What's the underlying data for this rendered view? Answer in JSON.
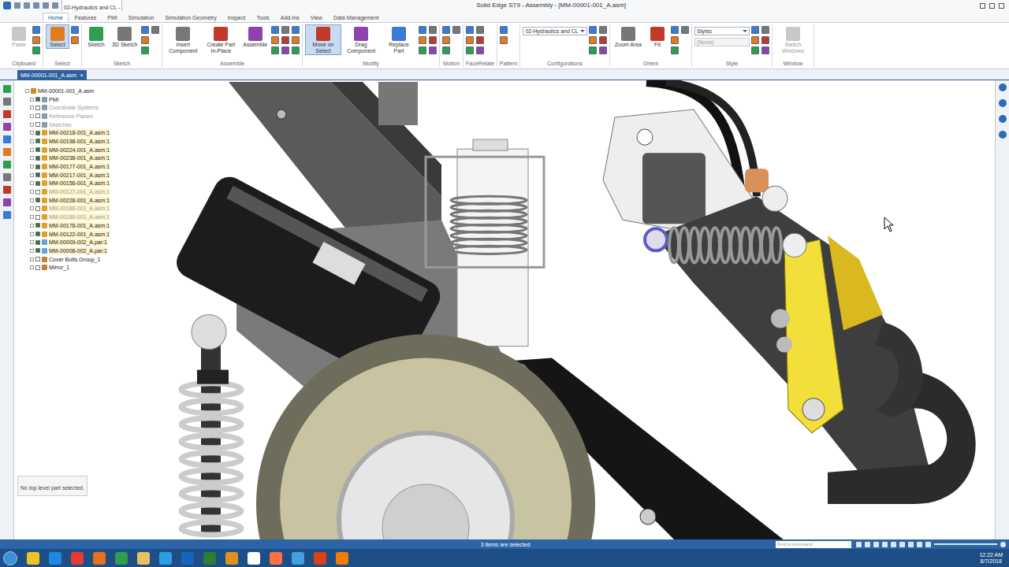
{
  "window": {
    "title": "Solid Edge ST9 - Assembly - [MM-00001-001_A.asm]",
    "quick_tab": "02-Hydraulics and CL -"
  },
  "ribbon_tabs": [
    {
      "label": "Home",
      "selected": true
    },
    {
      "label": "Features",
      "selected": false
    },
    {
      "label": "PMI",
      "selected": false
    },
    {
      "label": "Simulation",
      "selected": false
    },
    {
      "label": "Simulation Geometry",
      "selected": false
    },
    {
      "label": "Inspect",
      "selected": false
    },
    {
      "label": "Tools",
      "selected": false
    },
    {
      "label": "Add-Ins",
      "selected": false
    },
    {
      "label": "View",
      "selected": false
    },
    {
      "label": "Data Management",
      "selected": false
    }
  ],
  "ribbon_groups": [
    {
      "label": "Clipboard",
      "buttons": [
        {
          "label": "Paste",
          "disabled": true,
          "selected": false
        }
      ]
    },
    {
      "label": "Select",
      "buttons": [
        {
          "label": "Select",
          "disabled": false,
          "selected": true
        }
      ]
    },
    {
      "label": "Sketch",
      "buttons": [
        {
          "label": "Sketch",
          "disabled": false,
          "selected": false
        },
        {
          "label": "3D Sketch",
          "disabled": false,
          "selected": false
        }
      ]
    },
    {
      "label": "Assemble",
      "buttons": [
        {
          "label": "Insert Component",
          "disabled": false,
          "selected": false
        },
        {
          "label": "Create Part In-Place",
          "disabled": false,
          "selected": false
        },
        {
          "label": "Assemble",
          "disabled": false,
          "selected": false
        }
      ]
    },
    {
      "label": "Modify",
      "buttons": [
        {
          "label": "Move on Select",
          "disabled": false,
          "selected": true
        },
        {
          "label": "Drag Component",
          "disabled": false,
          "selected": false
        },
        {
          "label": "Replace Part",
          "disabled": false,
          "selected": false
        }
      ]
    },
    {
      "label": "Motion",
      "buttons": []
    },
    {
      "label": "FaceRelate",
      "buttons": []
    },
    {
      "label": "Pattern",
      "buttons": []
    },
    {
      "label": "Configurations",
      "buttons": [],
      "dropdown": "02-Hydraulics and CL"
    },
    {
      "label": "Orient",
      "buttons": [
        {
          "label": "Zoom Area",
          "disabled": false,
          "selected": false
        },
        {
          "label": "Fit",
          "disabled": false,
          "selected": false
        }
      ]
    },
    {
      "label": "Style",
      "buttons": [],
      "dropdown": "Styles",
      "dropdown2": "(None)"
    },
    {
      "label": "Window",
      "buttons": [
        {
          "label": "Switch Windows",
          "disabled": true,
          "selected": false
        }
      ]
    }
  ],
  "document_tab": {
    "label": "MM-00001-001_A.asm",
    "close": "×"
  },
  "tree": {
    "items": [
      {
        "label": "MM-00001-001_A.asm",
        "kind": "root",
        "checked": false,
        "greyed": false
      },
      {
        "label": "PMI",
        "kind": "folder",
        "checked": true,
        "greyed": false
      },
      {
        "label": "Coordinate Systems",
        "kind": "folder",
        "checked": false,
        "greyed": true
      },
      {
        "label": "Reference Planes",
        "kind": "folder",
        "checked": false,
        "greyed": true
      },
      {
        "label": "Sketches",
        "kind": "folder",
        "checked": false,
        "greyed": true
      },
      {
        "label": "MM-00218-001_A.asm:1",
        "kind": "asm",
        "checked": true,
        "greyed": false
      },
      {
        "label": "MM-00198-001_A.asm:1",
        "kind": "asm",
        "checked": true,
        "greyed": false
      },
      {
        "label": "MM-00224-001_A.asm:1",
        "kind": "asm",
        "checked": true,
        "greyed": false
      },
      {
        "label": "MM-00238-001_A.asm:1",
        "kind": "asm",
        "checked": true,
        "greyed": false
      },
      {
        "label": "MM-00177-001_A.asm:1",
        "kind": "asm",
        "checked": true,
        "greyed": false
      },
      {
        "label": "MM-00217-001_A.asm:1",
        "kind": "asm",
        "checked": true,
        "greyed": false
      },
      {
        "label": "MM-00156-001_A.asm:1",
        "kind": "asm",
        "checked": true,
        "greyed": false
      },
      {
        "label": "MM-00127-001_A.asm:1",
        "kind": "asm",
        "checked": false,
        "greyed": true
      },
      {
        "label": "MM-00228-001_A.asm:1",
        "kind": "asm",
        "checked": true,
        "greyed": false
      },
      {
        "label": "MM-00188-001_A.asm:1",
        "kind": "asm",
        "checked": false,
        "greyed": true
      },
      {
        "label": "MM-00180-001_A.asm:1",
        "kind": "asm",
        "checked": false,
        "greyed": true
      },
      {
        "label": "MM-00178-001_A.asm:1",
        "kind": "asm",
        "checked": true,
        "greyed": false
      },
      {
        "label": "MM-00122-001_A.asm:1",
        "kind": "asm",
        "checked": true,
        "greyed": false
      },
      {
        "label": "MM-00009-002_A.par:1",
        "kind": "par",
        "checked": true,
        "greyed": false
      },
      {
        "label": "MM-00008-002_A.par:1",
        "kind": "par",
        "checked": true,
        "greyed": false
      },
      {
        "label": "Cover Bolts Group_1",
        "kind": "group",
        "checked": false,
        "greyed": false
      },
      {
        "label": "Mirror_1",
        "kind": "group",
        "checked": false,
        "greyed": false
      }
    ],
    "message": "No top level part selected."
  },
  "status_bar": {
    "text": "3 items are selected",
    "search_placeholder": "Find a command"
  },
  "taskbar": {
    "time": "12:22 AM",
    "date": "8/7/2018"
  }
}
